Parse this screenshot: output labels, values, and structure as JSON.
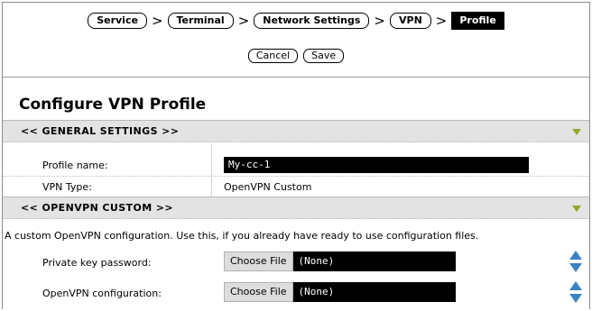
{
  "breadcrumb": {
    "items": [
      "Service",
      "Terminal",
      "Network Settings",
      "VPN"
    ],
    "separator": ">",
    "current": "Profile"
  },
  "actions": {
    "cancel_label": "Cancel",
    "save_label": "Save"
  },
  "page_title": "Configure VPN Profile",
  "general_section": {
    "label": "<<  GENERAL SETTINGS  >>",
    "fields": {
      "profile_name_label": "Profile name:",
      "profile_name_value": "My-cc-1",
      "vpn_type_label": "VPN Type:",
      "vpn_type_value": "OpenVPN Custom"
    }
  },
  "custom_section": {
    "label": "<<  OPENVPN CUSTOM  >>",
    "description": "A custom OpenVPN configuration. Use this, if you already have ready to use configuration files.",
    "fields": {
      "private_key_label": "Private key password:",
      "private_key_button": "Choose File",
      "private_key_value": "(None)",
      "openvpn_config_label": "OpenVPN configuration:",
      "openvpn_config_button": "Choose File",
      "openvpn_config_value": "(None)"
    }
  },
  "colors": {
    "collapse_triangle": "#8fa82a",
    "stepper": "#3b82c4",
    "section_bar": "#e3e3e3"
  },
  "icons": {
    "collapse": "triangle-down-icon",
    "stepper": "up-down-stepper-icon"
  }
}
